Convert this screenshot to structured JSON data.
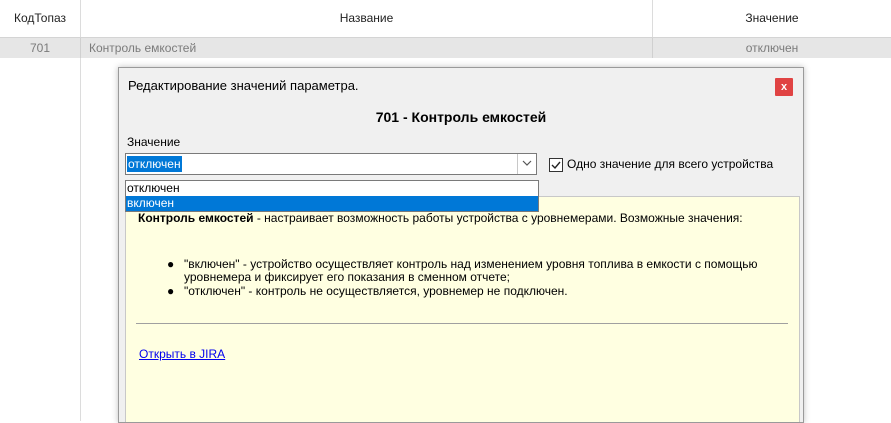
{
  "table": {
    "headers": {
      "code": "КодТопаз",
      "name": "Название",
      "value": "Значение"
    },
    "rows": [
      {
        "code": "701",
        "name": "Контроль емкостей",
        "value": "отключен"
      }
    ]
  },
  "dialog": {
    "title": "Редактирование значений параметра.",
    "close_label": "x",
    "param_title": "701 - Контроль емкостей",
    "value_label": "Значение",
    "combo_value": "отключен",
    "options": [
      "отключен",
      "включен"
    ],
    "selected_option_index": 1,
    "checkbox_checked": true,
    "checkbox_label": "Одно значение для всего устройства",
    "help": {
      "term": "Контроль емкостей",
      "description": " - настраивает возможность работы устройства с уровнемерами. Возможные значения:",
      "bullets": [
        "\"включен\" - устройство осуществляет контроль над изменением уровня топлива в емкости с помощью уровнемера и фиксирует его показания в сменном отчете;",
        "\"отключен\" - контроль не осуществляется, уровнемер не подключен."
      ],
      "link_text": "Открыть в JIRA"
    }
  },
  "icons": {
    "close": "close-icon",
    "dropdown": "chevron-down-icon",
    "check": "checkmark-icon"
  },
  "colors": {
    "selection": "#0078d7",
    "close_button": "#e04343",
    "help_background": "#ffffe1",
    "row_background": "#e6e6e6"
  }
}
